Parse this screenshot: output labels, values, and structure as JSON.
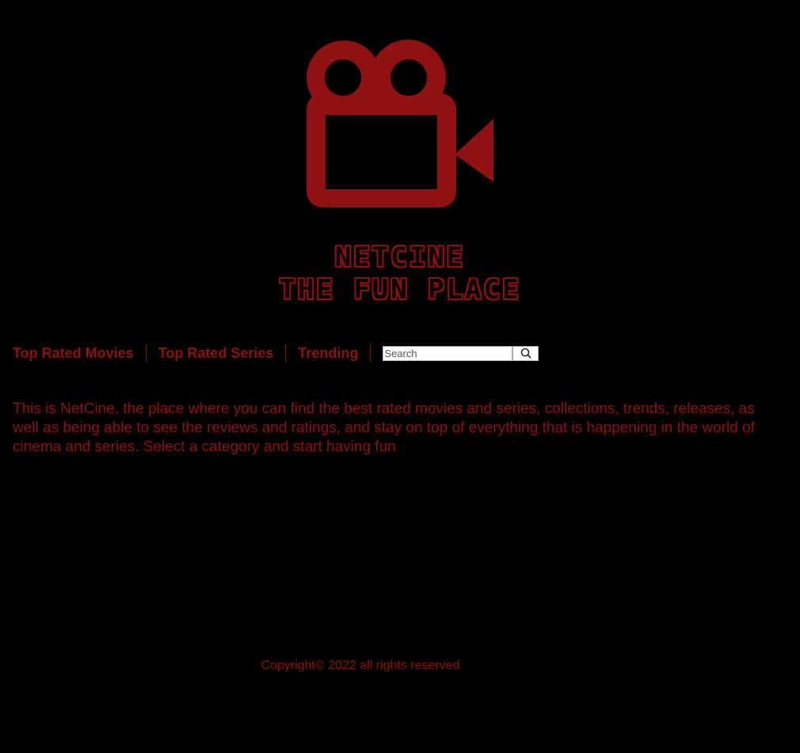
{
  "brand": {
    "name": "NETCINE",
    "tagline": "THE FUN PLACE",
    "logo_icon": "video-camera-icon",
    "accent_color": "#8f1111"
  },
  "nav": {
    "items": [
      {
        "label": "Top Rated Movies"
      },
      {
        "label": "Top Rated Series"
      },
      {
        "label": "Trending"
      }
    ],
    "search": {
      "placeholder": "Search",
      "button_icon": "search-icon"
    }
  },
  "intro": {
    "text": "This is NetCine, the place where you can find the best rated movies and series, collections, trends, releases, as well as being able to see the reviews and ratings, and stay on top of everything that is happening in the world of cinema and series. Select a category and start having fun"
  },
  "footer": {
    "copyright": "Copyright© 2022 all rights reserved"
  }
}
